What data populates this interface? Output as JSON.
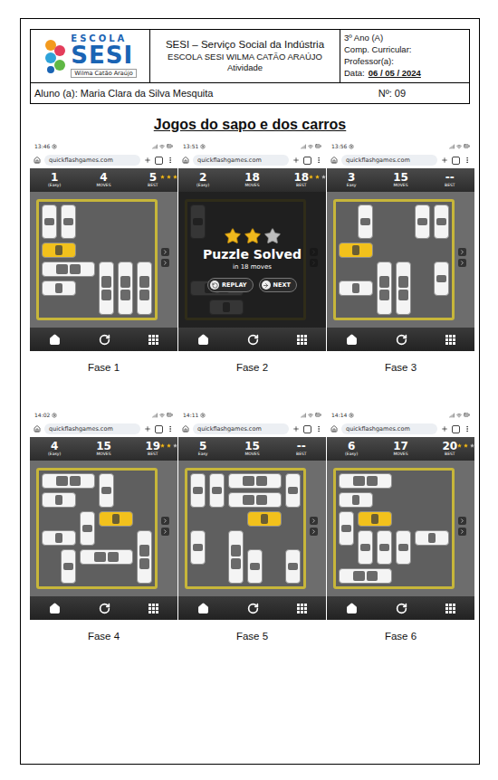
{
  "header": {
    "logo": {
      "top": "ESCOLA",
      "main": "SESI",
      "sub": "Wilma Catão Araújo"
    },
    "center": [
      "SESI – Serviço Social da Indústria",
      "ESCOLA SESI WILMA CATÃO ARAÚJO",
      "Atividade"
    ],
    "right": [
      "3º Ano (A)",
      "Comp. Curricular:",
      "Professor(a):"
    ],
    "date_label": "Data:",
    "date_value": "06 / 05 / 2024"
  },
  "student": {
    "name": "Aluno (a): Maria Clara da Silva Mesquita",
    "number": "Nº: 09"
  },
  "title": "Jogos do sapo e dos carros",
  "phases": [
    {
      "caption": "Fase 1",
      "time": "13:46",
      "url": "quickflashgames.com",
      "level": "1",
      "level_label": "(Easy)",
      "moves": "4",
      "moves_label": "MOVES",
      "best": "5",
      "best_label": "BEST",
      "stars": 3,
      "pieces": [
        {
          "kind": "car",
          "vertical": true,
          "row": 0,
          "col": 0,
          "color": "#f4f4f4"
        },
        {
          "kind": "car",
          "vertical": true,
          "row": 0,
          "col": 1,
          "color": "#f4f4f4"
        },
        {
          "kind": "car",
          "vertical": false,
          "row": 2,
          "col": 0,
          "color": "#f2c11c"
        },
        {
          "kind": "truck",
          "vertical": false,
          "row": 3,
          "col": 0,
          "color": "#f4f4f4"
        },
        {
          "kind": "car",
          "vertical": false,
          "row": 4,
          "col": 0,
          "color": "#f4f4f4"
        },
        {
          "kind": "truck",
          "vertical": true,
          "row": 3,
          "col": 3,
          "color": "#f4f4f4"
        },
        {
          "kind": "truck",
          "vertical": true,
          "row": 3,
          "col": 4,
          "color": "#f4f4f4"
        },
        {
          "kind": "truck",
          "vertical": true,
          "row": 3,
          "col": 5,
          "color": "#f4f4f4"
        }
      ]
    },
    {
      "caption": "Fase 2",
      "time": "13:51",
      "url": "quickflashgames.com",
      "level": "2",
      "level_label": "(Easy)",
      "moves": "18",
      "moves_label": "MOVES",
      "best": "18",
      "best_label": "BEST",
      "stars": 2,
      "overlay": {
        "title": "Puzzle Solved",
        "subtitle": "in 18 moves",
        "stars": 2,
        "buttons": [
          "REPLAY",
          "NEXT"
        ]
      },
      "pieces": [
        {
          "kind": "car",
          "vertical": true,
          "row": 0,
          "col": 0,
          "color": "#f4f4f4"
        },
        {
          "kind": "truck",
          "vertical": false,
          "row": 4,
          "col": 0,
          "color": "#f4f4f4"
        },
        {
          "kind": "car",
          "vertical": false,
          "row": 5,
          "col": 1,
          "color": "#f4f4f4"
        }
      ]
    },
    {
      "caption": "Fase 3",
      "time": "13:56",
      "url": "quickflashgames.com",
      "level": "3",
      "level_label": "Easy",
      "moves": "15",
      "moves_label": "MOVES",
      "best": "--",
      "best_label": "BEST",
      "pieces": [
        {
          "kind": "car",
          "vertical": true,
          "row": 0,
          "col": 1,
          "color": "#f4f4f4"
        },
        {
          "kind": "car",
          "vertical": true,
          "row": 0,
          "col": 4,
          "color": "#f4f4f4"
        },
        {
          "kind": "car",
          "vertical": true,
          "row": 0,
          "col": 5,
          "color": "#f4f4f4"
        },
        {
          "kind": "car",
          "vertical": false,
          "row": 2,
          "col": 0,
          "color": "#f2c11c"
        },
        {
          "kind": "truck",
          "vertical": true,
          "row": 3,
          "col": 2,
          "color": "#f4f4f4"
        },
        {
          "kind": "truck",
          "vertical": true,
          "row": 3,
          "col": 3,
          "color": "#f4f4f4"
        },
        {
          "kind": "car",
          "vertical": false,
          "row": 4,
          "col": 0,
          "color": "#f4f4f4"
        },
        {
          "kind": "car",
          "vertical": true,
          "row": 3,
          "col": 5,
          "color": "#f4f4f4"
        }
      ]
    },
    {
      "caption": "Fase 4",
      "time": "14:02",
      "url": "quickflashgames.com",
      "level": "4",
      "level_label": "(Easy)",
      "moves": "15",
      "moves_label": "MOVES",
      "best": "19",
      "best_label": "BEST",
      "stars": 2,
      "pieces": [
        {
          "kind": "truck",
          "vertical": false,
          "row": 0,
          "col": 0,
          "color": "#f4f4f4"
        },
        {
          "kind": "car",
          "vertical": true,
          "row": 0,
          "col": 3,
          "color": "#f4f4f4"
        },
        {
          "kind": "car",
          "vertical": false,
          "row": 1,
          "col": 0,
          "color": "#f4f4f4"
        },
        {
          "kind": "car",
          "vertical": true,
          "row": 2,
          "col": 2,
          "color": "#f4f4f4"
        },
        {
          "kind": "car",
          "vertical": false,
          "row": 2,
          "col": 3,
          "color": "#f2c11c"
        },
        {
          "kind": "car",
          "vertical": false,
          "row": 3,
          "col": 0,
          "color": "#f4f4f4"
        },
        {
          "kind": "truck",
          "vertical": false,
          "row": 4,
          "col": 2,
          "color": "#f4f4f4"
        },
        {
          "kind": "truck",
          "vertical": true,
          "row": 3,
          "col": 5,
          "color": "#f4f4f4"
        },
        {
          "kind": "car",
          "vertical": true,
          "row": 4,
          "col": 1,
          "color": "#f4f4f4"
        }
      ]
    },
    {
      "caption": "Fase 5",
      "time": "14:11",
      "url": "quickflashgames.com",
      "level": "5",
      "level_label": "Easy",
      "moves": "15",
      "moves_label": "MOVES",
      "best": "--",
      "best_label": "BEST",
      "pieces": [
        {
          "kind": "car",
          "vertical": true,
          "row": 0,
          "col": 0,
          "color": "#f4f4f4"
        },
        {
          "kind": "car",
          "vertical": true,
          "row": 0,
          "col": 1,
          "color": "#f4f4f4"
        },
        {
          "kind": "truck",
          "vertical": false,
          "row": 0,
          "col": 2,
          "color": "#f4f4f4"
        },
        {
          "kind": "truck",
          "vertical": false,
          "row": 1,
          "col": 2,
          "color": "#f4f4f4"
        },
        {
          "kind": "car",
          "vertical": true,
          "row": 0,
          "col": 5,
          "color": "#f4f4f4"
        },
        {
          "kind": "car",
          "vertical": false,
          "row": 2,
          "col": 3,
          "color": "#f2c11c"
        },
        {
          "kind": "truck",
          "vertical": true,
          "row": 3,
          "col": 2,
          "color": "#f4f4f4"
        },
        {
          "kind": "car",
          "vertical": true,
          "row": 4,
          "col": 3,
          "color": "#f4f4f4"
        },
        {
          "kind": "car",
          "vertical": true,
          "row": 4,
          "col": 5,
          "color": "#f4f4f4"
        },
        {
          "kind": "car",
          "vertical": true,
          "row": 3,
          "col": 0,
          "color": "#f4f4f4"
        }
      ]
    },
    {
      "caption": "Fase 6",
      "time": "14:14",
      "url": "quickflashgames.com",
      "level": "6",
      "level_label": "(Easy)",
      "moves": "17",
      "moves_label": "MOVES",
      "best": "20",
      "best_label": "BEST",
      "stars": 2,
      "pieces": [
        {
          "kind": "truck",
          "vertical": false,
          "row": 0,
          "col": 0,
          "color": "#f4f4f4"
        },
        {
          "kind": "car",
          "vertical": false,
          "row": 1,
          "col": 0,
          "color": "#f4f4f4"
        },
        {
          "kind": "car",
          "vertical": false,
          "row": 2,
          "col": 1,
          "color": "#f2c11c"
        },
        {
          "kind": "car",
          "vertical": true,
          "row": 2,
          "col": 0,
          "color": "#f4f4f4"
        },
        {
          "kind": "car",
          "vertical": true,
          "row": 3,
          "col": 1,
          "color": "#f4f4f4"
        },
        {
          "kind": "car",
          "vertical": true,
          "row": 3,
          "col": 2,
          "color": "#f4f4f4"
        },
        {
          "kind": "car",
          "vertical": true,
          "row": 3,
          "col": 3,
          "color": "#f4f4f4"
        },
        {
          "kind": "car",
          "vertical": false,
          "row": 3,
          "col": 4,
          "color": "#f4f4f4"
        },
        {
          "kind": "truck",
          "vertical": false,
          "row": 5,
          "col": 0,
          "color": "#f4f4f4"
        }
      ]
    }
  ]
}
